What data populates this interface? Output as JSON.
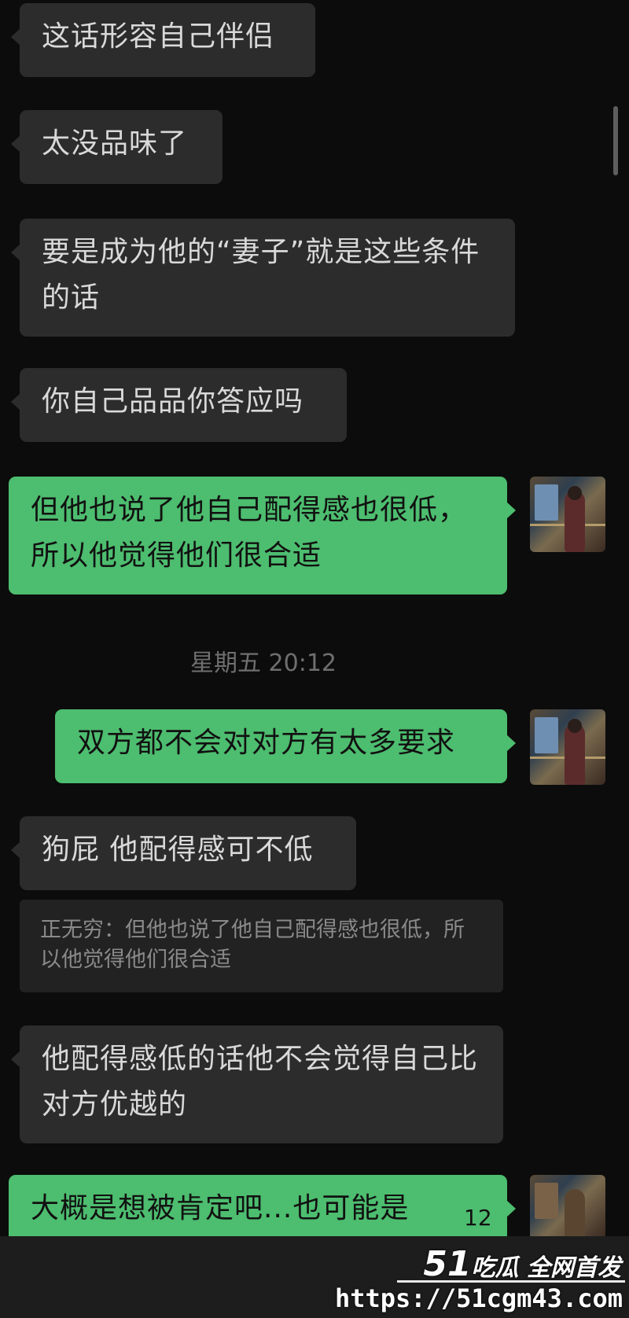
{
  "conversation": {
    "messages": [
      {
        "side": "in",
        "text": "这话形容自己伴侣"
      },
      {
        "side": "in",
        "text": "太没品味了"
      },
      {
        "side": "in",
        "text": "要是成为他的“妻子”就是这些条件的话"
      },
      {
        "side": "in",
        "text": "你自己品品你答应吗"
      },
      {
        "side": "out",
        "text": "但他也说了他自己配得感也很低，所以他觉得他们很合适"
      },
      {
        "side": "out",
        "text": "双方都不会对对方有太多要求"
      },
      {
        "side": "in",
        "text": "狗屁 他配得感可不低"
      },
      {
        "side": "in",
        "text": "他配得感低的话他不会觉得自己比对方优越的"
      },
      {
        "side": "out",
        "text": "大概是想被肯定吧...也可能是"
      }
    ],
    "timestamp": "星期五 20:12",
    "quote": "正无穷：但他也说了他自己配得感也很低，所以他觉得他们很合适",
    "partial_badge": "12"
  },
  "watermark": {
    "brand_number": "51",
    "brand_text": "吃瓜 全网首发",
    "url": "https://51cgm43.com"
  },
  "colors": {
    "background": "#0c0c0c",
    "incoming_bubble": "#2c2c2c",
    "outgoing_bubble": "#4dbd6f"
  }
}
